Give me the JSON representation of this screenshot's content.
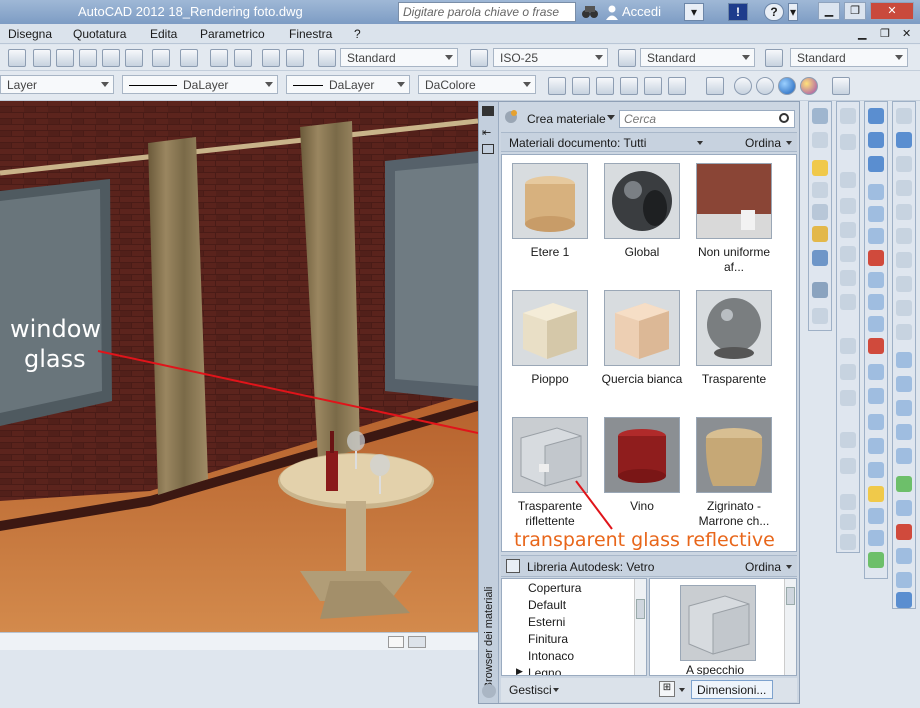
{
  "window": {
    "title": "AutoCAD 2012   18_Rendering foto.dwg",
    "search_placeholder": "Digitare parola chiave o frase",
    "login": "Accedi",
    "help": "?",
    "exclam": "!"
  },
  "menu": [
    "Disegna",
    "Quotatura",
    "Edita",
    "Parametrico",
    "Finestra",
    "?"
  ],
  "toolbar1": {
    "text_style": "Standard",
    "dim_style": "ISO-25",
    "table_style": "Standard",
    "mleader_style": "Standard"
  },
  "toolbar2": {
    "layer": "Layer",
    "linetype": "DaLayer",
    "lineweight": "DaLayer",
    "color": "DaColore"
  },
  "annotations": {
    "window_glass_1": "window",
    "window_glass_2": "glass",
    "transparent_glass": "transparent glass reflective",
    "color_red": "#e0141a",
    "color_orange": "#e8661a"
  },
  "palette": {
    "vertical_title": "Browser dei materiali",
    "create_material": "Crea materiale",
    "search_placeholder": "Cerca",
    "doc_materials": "Materiali documento: Tutti",
    "sort": "Ordina",
    "materials": [
      {
        "name": "Etere 1",
        "kind": "wood"
      },
      {
        "name": "Global",
        "kind": "sphere-dark"
      },
      {
        "name": "Non uniforme af...",
        "kind": "brick"
      },
      {
        "name": "Pioppo",
        "kind": "cube-light"
      },
      {
        "name": "Quercia bianca",
        "kind": "cube-peach"
      },
      {
        "name": "Trasparente",
        "kind": "glass-sphere"
      },
      {
        "name": "Trasparente riflettente",
        "kind": "glass-cube"
      },
      {
        "name": "Vino",
        "kind": "red-cylinder"
      },
      {
        "name": "Zigrinato - Marrone ch...",
        "kind": "cloth"
      }
    ],
    "library_title": "Libreria Autodesk: Vetro",
    "library_sort": "Ordina",
    "library_items": [
      "Copertura",
      "Default",
      "Esterni",
      "Finitura",
      "Intonaco",
      "Legno"
    ],
    "preview_label": "A specchio",
    "manage": "Gestisci",
    "size_button": "Dimensioni..."
  }
}
